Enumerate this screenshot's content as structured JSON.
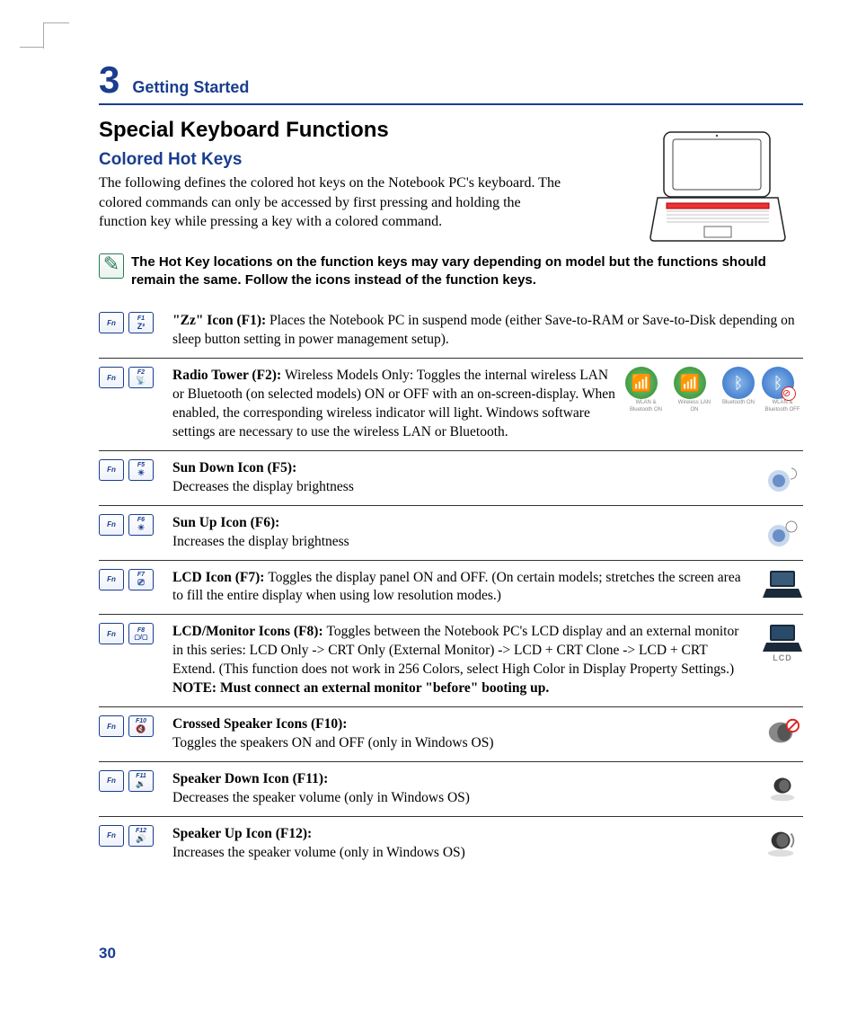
{
  "chapter": {
    "number": "3",
    "title": "Getting Started"
  },
  "h1": "Special Keyboard Functions",
  "h2": "Colored Hot Keys",
  "intro": "The following defines the colored hot keys on the Notebook PC's keyboard. The colored commands can only be accessed by first pressing and holding the function key while pressing a key with a colored command.",
  "note": "The Hot Key locations on the function keys may vary depending on model but the functions should remain the same. Follow the icons instead of the function keys.",
  "fn_label": "Fn",
  "rows": [
    {
      "key": "F1",
      "glyph": "Z²",
      "title": "\"Zz\" Icon (F1): ",
      "body": "Places the Notebook PC in suspend mode (either Save-to-RAM or Save-to-Disk depending on sleep button setting in power management setup)."
    },
    {
      "key": "F2",
      "glyph": "📡",
      "title": "Radio Tower (F2): ",
      "body": "Wireless Models Only: Toggles the internal wireless LAN or Bluetooth (on selected models) ON or OFF with an on-screen-display. When enabled, the corresponding wireless indicator will light. Windows software settings are necessary to use the wireless LAN or Bluetooth."
    },
    {
      "key": "F5",
      "glyph": "☀",
      "title": "Sun Down Icon (F5):",
      "body": "Decreases the display brightness"
    },
    {
      "key": "F6",
      "glyph": "☀",
      "title": "Sun Up Icon (F6):",
      "body": "Increases the display brightness"
    },
    {
      "key": "F7",
      "glyph": "⎚",
      "title": "LCD Icon (F7): ",
      "body": "Toggles the display panel ON and OFF. (On certain models; stretch­es the screen area to fill the entire display when using low resolution modes.)"
    },
    {
      "key": "F8",
      "glyph": "▢/▢",
      "title": "LCD/Monitor Icons (F8): ",
      "body": "Toggles between the Notebook PC's LCD display and an external monitor in this series: LCD Only -> CRT Only (External Monitor) -> LCD + CRT Clone -> LCD + CRT Extend. (This function does not work in 256 Colors, select High Color in Display Property Settings.) ",
      "note": "NOTE: Must connect an external monitor \"before\" booting up."
    },
    {
      "key": "F10",
      "glyph": "🔇",
      "title": "Crossed Speaker Icons (F10):",
      "body": "Toggles the speakers ON and OFF (only in Windows OS)"
    },
    {
      "key": "F11",
      "glyph": "🔉",
      "title": "Speaker Down Icon (F11):",
      "body": "Decreases the speaker volume (only in Windows OS)"
    },
    {
      "key": "F12",
      "glyph": "🔊",
      "title": "Speaker Up Icon (F12):",
      "body": "Increases the speaker volume (only in Windows OS)"
    }
  ],
  "wifi_badges": [
    "WLAN & Bluetooth ON",
    "Wireless LAN ON",
    "Bluetooth ON",
    "WLAN & Bluetooth OFF"
  ],
  "lcd_label": "LCD",
  "page": "30"
}
